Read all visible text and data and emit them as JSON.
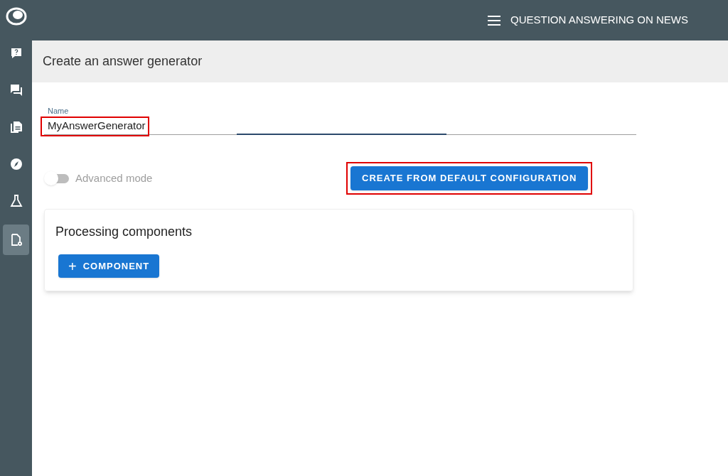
{
  "app_bar": {
    "title": "QUESTION ANSWERING ON NEWS"
  },
  "sidebar": {
    "items": [
      {
        "kind": "question",
        "selected": false
      },
      {
        "kind": "chat",
        "selected": false
      },
      {
        "kind": "documents",
        "selected": false
      },
      {
        "kind": "compass",
        "selected": false
      },
      {
        "kind": "flask",
        "selected": false
      },
      {
        "kind": "config",
        "selected": true
      }
    ]
  },
  "page_header": {
    "title": "Create an answer generator"
  },
  "name_field": {
    "label": "Name",
    "value": "MyAnswerGenerator",
    "highlighted": true
  },
  "advanced_mode": {
    "label": "Advanced mode",
    "on": false
  },
  "default_button": {
    "label": "CREATE FROM DEFAULT CONFIGURATION",
    "highlighted": true
  },
  "components_card": {
    "title": "Processing components",
    "add_button": {
      "icon": "+",
      "label": "COMPONENT"
    }
  }
}
